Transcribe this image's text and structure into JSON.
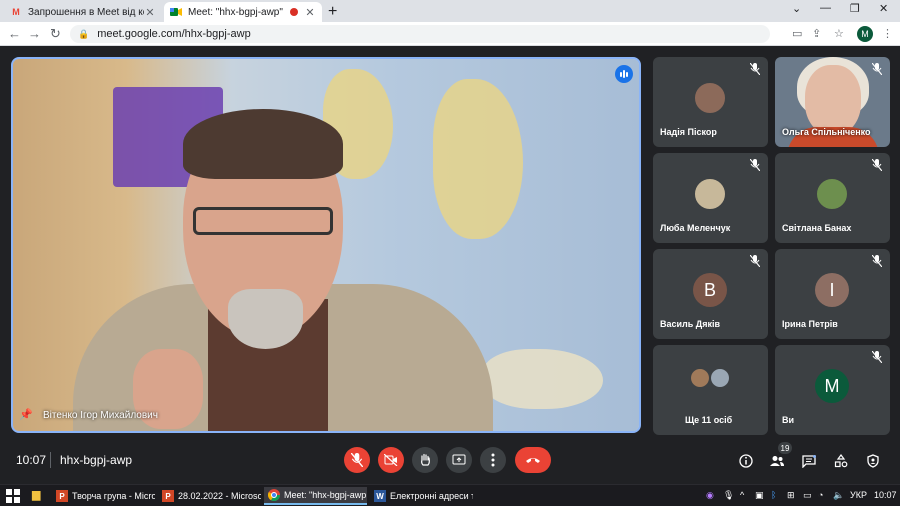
{
  "browser": {
    "tabs": [
      {
        "title": "Запрошення в Meet від користу",
        "favicon": "gmail-icon"
      },
      {
        "title": "Meet: \"hhx-bgpj-awp\"",
        "favicon": "meet-icon",
        "recording": true
      }
    ],
    "url": "meet.google.com/hhx-bgpj-awp",
    "profile_initial": "M"
  },
  "main_video": {
    "speaker_name": "Вітенко Ігор Михайлович"
  },
  "participants": [
    {
      "name": "Надія Піскор",
      "muted": true,
      "avatar_type": "photo",
      "avatar_color": "#8c6a5a"
    },
    {
      "name": "Ольга Спільніченко",
      "muted": true,
      "avatar_type": "video"
    },
    {
      "name": "Люба Меленчук",
      "muted": true,
      "avatar_type": "photo",
      "avatar_color": "#c7b89a"
    },
    {
      "name": "Світлана Банах",
      "muted": true,
      "avatar_type": "photo",
      "avatar_color": "#6d8f4e"
    },
    {
      "name": "Василь Дяків",
      "muted": true,
      "avatar_type": "letter",
      "letter": "В",
      "avatar_color": "#795548"
    },
    {
      "name": "Ірина Петрів",
      "muted": true,
      "avatar_type": "letter",
      "letter": "І",
      "avatar_color": "#8d6e63"
    },
    {
      "name": "Ще 11 осіб",
      "muted": false,
      "avatar_type": "stack"
    },
    {
      "name": "Ви",
      "muted": true,
      "avatar_type": "letter",
      "letter": "M",
      "avatar_color": "#0b5a3b"
    }
  ],
  "bottom_bar": {
    "time": "10:07",
    "meeting_code": "hhx-bgpj-awp",
    "participant_count": "19"
  },
  "taskbar": {
    "items": [
      {
        "label": "Творча група - Micro...",
        "icon_letter": "P",
        "icon_color": "#d24726"
      },
      {
        "label": "28.02.2022 - Microsof...",
        "icon_letter": "P",
        "icon_color": "#d24726"
      },
      {
        "label": "Meet: \"hhx-bgpj-awp...",
        "icon_letter": "",
        "icon_color": "#4285f4",
        "active": true
      },
      {
        "label": "Електронні адреси т...",
        "icon_letter": "W",
        "icon_color": "#2b579a"
      }
    ],
    "language": "УКР",
    "clock": "10:07"
  },
  "colors": {
    "accent_blue": "#8ab4f8",
    "danger_red": "#ea4335",
    "tile_bg": "#3c4043",
    "app_bg": "#202124"
  }
}
